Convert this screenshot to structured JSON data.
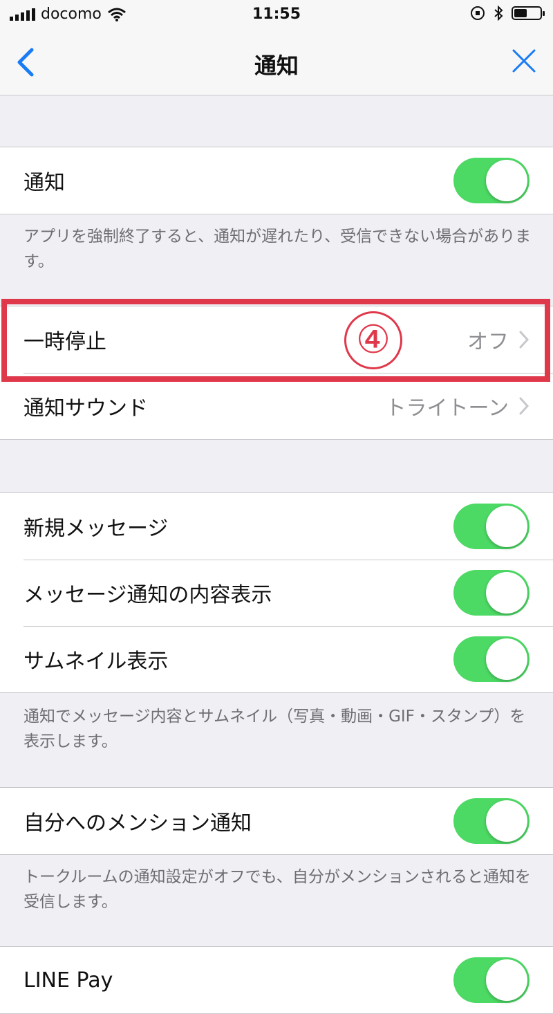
{
  "status_bar": {
    "carrier": "docomo",
    "time": "11:55"
  },
  "nav": {
    "title": "通知",
    "back_icon": "chevron-left-icon",
    "close_icon": "close-icon"
  },
  "section1": {
    "row_label": "通知",
    "toggle_on": true,
    "footer": "アプリを強制終了すると、通知が遅れたり、受信できない場合があります。"
  },
  "section2": {
    "rows": [
      {
        "label": "一時停止",
        "value": "オフ"
      },
      {
        "label": "通知サウンド",
        "value": "トライトーン"
      }
    ]
  },
  "annotation": {
    "step_number": "④",
    "color": "#e0384b"
  },
  "section3": {
    "rows": [
      {
        "label": "新規メッセージ",
        "toggle_on": true
      },
      {
        "label": "メッセージ通知の内容表示",
        "toggle_on": true
      },
      {
        "label": "サムネイル表示",
        "toggle_on": true
      }
    ],
    "footer": "通知でメッセージ内容とサムネイル（写真・動画・GIF・スタンプ）を表示します。"
  },
  "section4": {
    "row_label": "自分へのメンション通知",
    "toggle_on": true,
    "footer": "トークルームの通知設定がオフでも、自分がメンションされると通知を受信します。"
  },
  "section5": {
    "row_label": "LINE Pay",
    "toggle_on": true
  },
  "colors": {
    "accent": "#1a7cf5",
    "toggle_on": "#4cd964",
    "highlight": "#e0384b"
  }
}
